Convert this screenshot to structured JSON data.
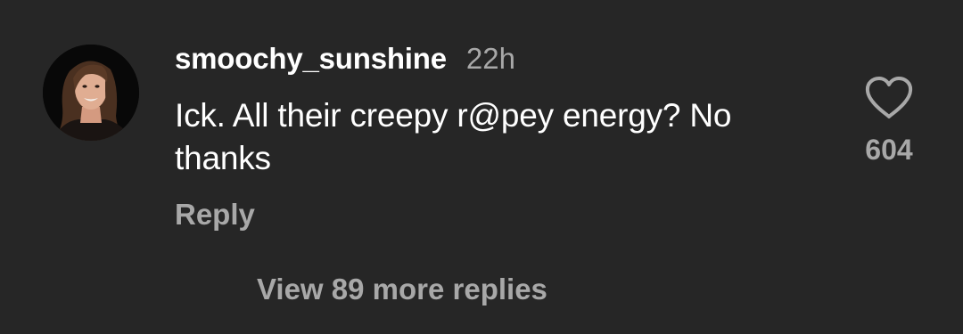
{
  "comment": {
    "username": "smoochy_sunshine",
    "timestamp": "22h",
    "text": "Ick. All their creepy r@pey energy? No thanks",
    "reply_label": "Reply",
    "like_count": "604",
    "view_replies_label": "View 89 more replies",
    "avatar_icon": "profile-photo",
    "like_icon": "heart-outline-icon"
  },
  "colors": {
    "background": "#262626",
    "primary_text": "#ffffff",
    "secondary_text": "#a8a8a8"
  }
}
